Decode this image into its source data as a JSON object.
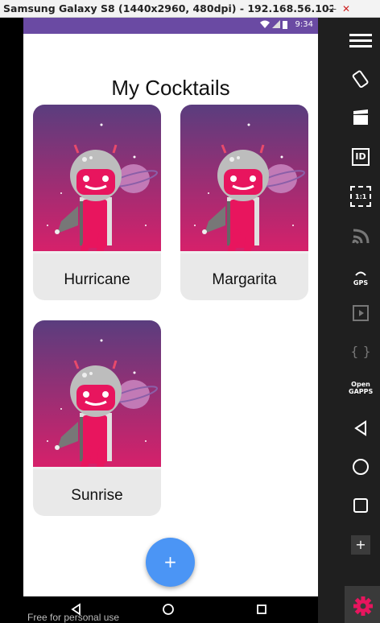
{
  "window": {
    "title": "Samsung Galaxy S8 (1440x2960, 480dpi) - 192.168.56.102:...",
    "minimize_label": "—",
    "close_label": "✕"
  },
  "statusbar": {
    "time": "9:34",
    "icons": [
      "wifi-icon",
      "signal-icon",
      "battery-icon"
    ]
  },
  "app": {
    "title": "My Cocktails",
    "cards": [
      {
        "label": "Hurricane"
      },
      {
        "label": "Margarita"
      },
      {
        "label": "Sunrise"
      }
    ],
    "fab_label": "+"
  },
  "navbar": {
    "buttons": [
      "back-icon",
      "home-icon",
      "recents-icon"
    ]
  },
  "watermark": "Free for personal use",
  "toolbar": {
    "buttons": [
      {
        "name": "menu-icon"
      },
      {
        "name": "rotate-icon"
      },
      {
        "name": "screen-record-icon"
      },
      {
        "name": "device-id-icon",
        "label": "ID"
      },
      {
        "name": "pixel-perfect-icon",
        "label": "1:1"
      },
      {
        "name": "cast-icon"
      },
      {
        "name": "gps-icon",
        "label": "GPS"
      },
      {
        "name": "media-icon"
      },
      {
        "name": "javascript-icon",
        "label": "{ }"
      },
      {
        "name": "open-gapps-icon",
        "label": "Open GAPPS"
      },
      {
        "name": "back-icon"
      },
      {
        "name": "home-icon"
      },
      {
        "name": "recents-icon"
      },
      {
        "name": "plus-icon",
        "label": "+"
      },
      {
        "name": "settings-icon"
      }
    ]
  },
  "colors": {
    "status_bar": "#6a4aa3",
    "fab": "#4b95f5",
    "card_bg": "#e9e9e9",
    "art_top": "#5a3d7e",
    "art_bottom": "#d8206a",
    "robot_accent": "#e8155e",
    "settings_accent": "#e8155e"
  }
}
